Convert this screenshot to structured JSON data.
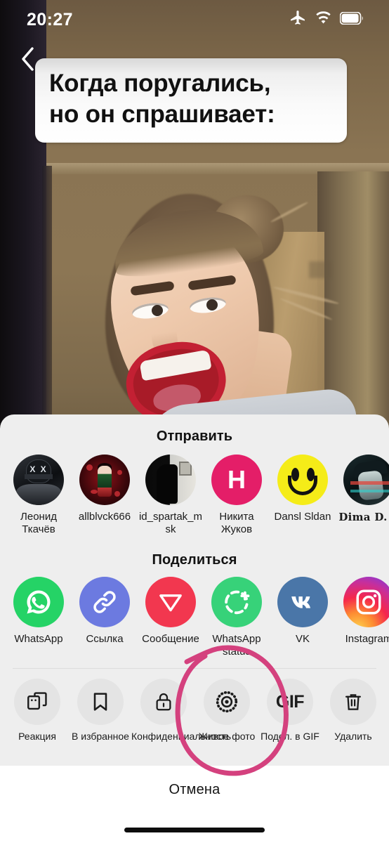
{
  "status_bar": {
    "time": "20:27",
    "icons": [
      "airplane-mode-icon",
      "wifi-icon",
      "battery-icon"
    ]
  },
  "video": {
    "back_icon": "chevron-left-icon",
    "caption_lines": [
      "Когда поругались,",
      "но он спрашивает:"
    ]
  },
  "share_sheet": {
    "send": {
      "title": "Отправить",
      "contacts": [
        {
          "label": "Леонид Ткачёв",
          "avatar": "masked-person-photo"
        },
        {
          "label": "allblvck666",
          "avatar": "red-anime-photo"
        },
        {
          "label": "id_spartak_msk",
          "avatar": "black-white-photo"
        },
        {
          "label": "Никита Жуков",
          "avatar": "letter-initial",
          "initial": "Н",
          "color": "#e41e68"
        },
        {
          "label": "Dansl Sldan",
          "avatar": "smiley-face",
          "color": "#f5ec18"
        },
        {
          "label": "Dima D. ʊ",
          "avatar": "glitch-portrait-photo"
        }
      ]
    },
    "share": {
      "title": "Поделиться",
      "apps": [
        {
          "label": "WhatsApp",
          "icon": "whatsapp-icon",
          "color": "#25d366"
        },
        {
          "label": "Ссылка",
          "icon": "link-icon",
          "color": "#6c7ae0"
        },
        {
          "label": "Сообщение",
          "icon": "paper-plane-icon",
          "color": "#f2374f"
        },
        {
          "label": "WhatsApp status",
          "icon": "whatsapp-status-icon",
          "color": "#37d279"
        },
        {
          "label": "VK",
          "icon": "vk-icon",
          "color": "#4a76a8"
        },
        {
          "label": "Instagram",
          "icon": "instagram-icon",
          "color": "#c9379d"
        }
      ]
    },
    "actions": [
      {
        "label": "Реакция",
        "icon": "reaction-icon"
      },
      {
        "label": "В избранное",
        "icon": "bookmark-icon"
      },
      {
        "label": "Конфиденциальность",
        "icon": "lock-icon"
      },
      {
        "label": "Живое фото",
        "icon": "live-photo-icon",
        "highlighted": true
      },
      {
        "label": "Подел. в GIF",
        "icon": "gif-icon",
        "text": "GIF"
      },
      {
        "label": "Удалить",
        "icon": "trash-icon"
      }
    ],
    "cancel_label": "Отмена"
  },
  "annotation": {
    "shape": "hand-drawn-circle",
    "color": "#d4417e",
    "target": "Живое фото"
  }
}
